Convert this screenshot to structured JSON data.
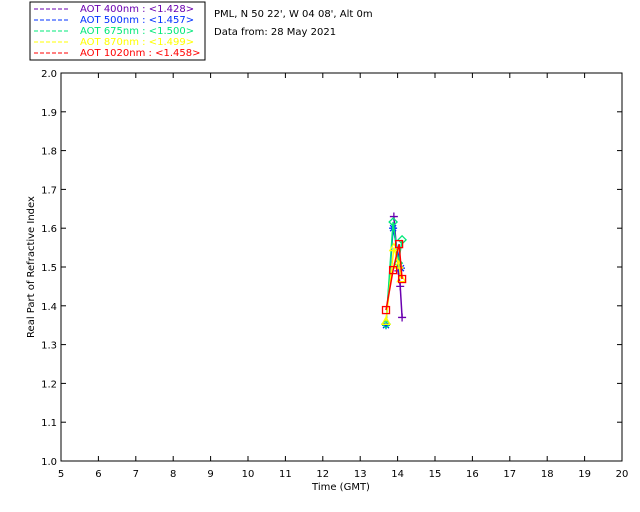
{
  "chart_data": {
    "type": "line",
    "header": {
      "site": "PML, N 50 22', W 04 08', Alt 0m",
      "date": "Data from: 28 May 2021"
    },
    "xlabel": "Time (GMT)",
    "ylabel": "Real Part of Refractive Index",
    "xlim": [
      5,
      20
    ],
    "ylim": [
      1.0,
      2.0
    ],
    "xticks": [
      "5",
      "6",
      "7",
      "8",
      "9",
      "10",
      "11",
      "12",
      "13",
      "14",
      "15",
      "16",
      "17",
      "18",
      "19",
      "20"
    ],
    "yticks": [
      "1.0",
      "1.1",
      "1.2",
      "1.3",
      "1.4",
      "1.5",
      "1.6",
      "1.7",
      "1.8",
      "1.9",
      "2.0"
    ],
    "legend_position": "top-left-outside",
    "series": [
      {
        "name": "AOT  400nm : <1.428>",
        "color": "#6a00b0",
        "marker": "plus",
        "x": [
          13.9,
          14.02,
          14.07,
          14.12
        ],
        "y": [
          1.63,
          1.49,
          1.45,
          1.37
        ]
      },
      {
        "name": "AOT  500nm : <1.457>",
        "color": "#0030ff",
        "marker": "asterisk",
        "x": [
          13.69,
          13.88,
          14.09
        ],
        "y": [
          1.35,
          1.6,
          1.497
        ]
      },
      {
        "name": "AOT  675nm : <1.500>",
        "color": "#00e878",
        "marker": "diamond",
        "x": [
          13.69,
          13.88,
          14.02,
          14.12
        ],
        "y": [
          1.353,
          1.616,
          1.51,
          1.57
        ]
      },
      {
        "name": "AOT  870nm : <1.499>",
        "color": "#ffff00",
        "marker": "triangle",
        "x": [
          13.69,
          13.9,
          14.03,
          14.1
        ],
        "y": [
          1.36,
          1.55,
          1.505,
          1.47
        ]
      },
      {
        "name": "AOT 1020nm : <1.458>",
        "color": "#ff0000",
        "marker": "square",
        "x": [
          13.69,
          13.88,
          14.04,
          14.12
        ],
        "y": [
          1.389,
          1.492,
          1.559,
          1.469
        ]
      }
    ]
  }
}
